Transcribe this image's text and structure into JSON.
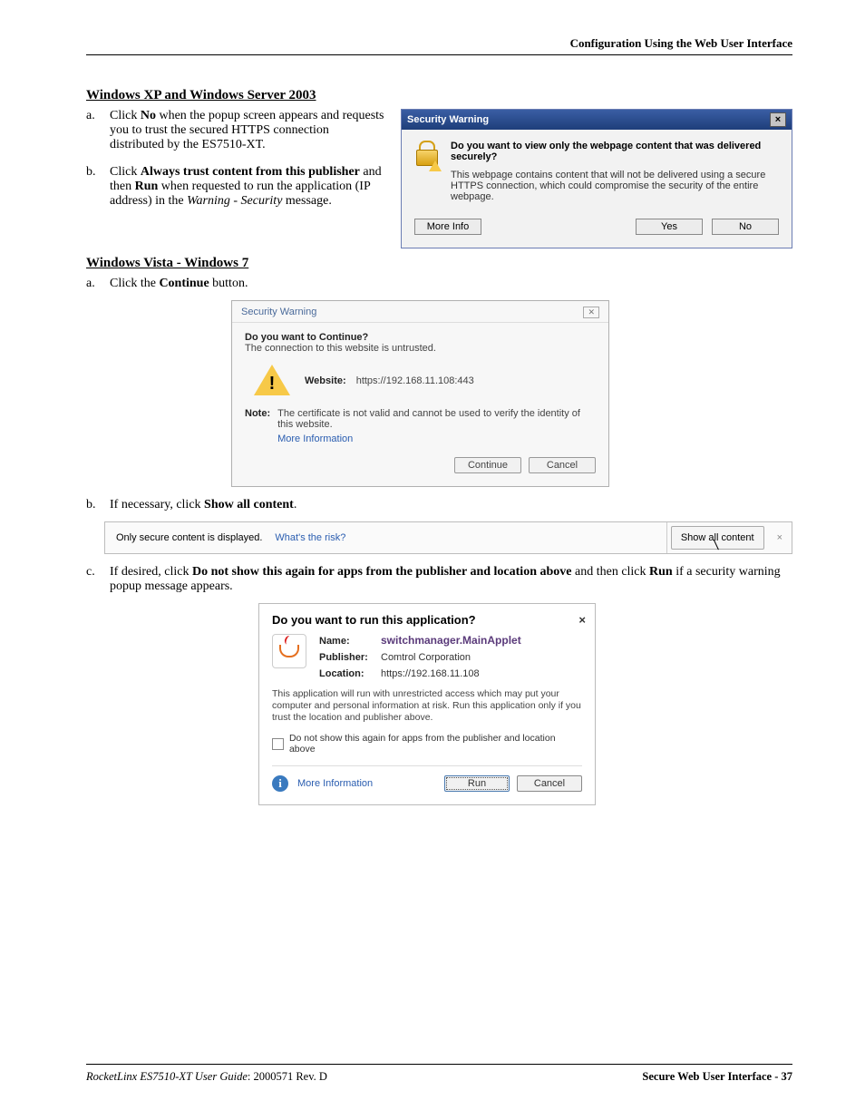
{
  "header": {
    "right": "Configuration Using the Web User Interface"
  },
  "sections": {
    "xp": {
      "title": "Windows XP and Windows Server 2003",
      "a_marker": "a.",
      "a_pre": "Click ",
      "a_bold1": "No",
      "a_post": " when the popup screen appears and requests you to trust the secured HTTPS connection distributed by the ES7510-XT.",
      "b_marker": "b.",
      "b_pre": "Click ",
      "b_bold1": "Always trust content from this publisher",
      "b_mid1": " and then ",
      "b_bold2": "Run",
      "b_mid2": " when requested to run the application (IP address) in the ",
      "b_ital": "Warning - Security",
      "b_post": " message."
    },
    "vista": {
      "title": "Windows Vista - Windows 7",
      "a_marker": "a.",
      "a_pre": "Click the ",
      "a_bold": "Continue",
      "a_post": " button.",
      "b_marker": "b.",
      "b_pre": "If necessary, click ",
      "b_bold": "Show all content",
      "b_post": ".",
      "c_marker": "c.",
      "c_pre": "If desired, click ",
      "c_bold1": "Do not show this again for apps from the publisher and location above",
      "c_mid": " and then click ",
      "c_bold2": "Run",
      "c_post": " if a security warning popup message appears."
    }
  },
  "dlgXp": {
    "title": "Security Warning",
    "question": "Do you want to view only the webpage content that was delivered securely?",
    "message": "This webpage contains content that will not be delivered using a secure HTTPS connection, which could compromise the security of the entire webpage.",
    "moreInfo": "More Info",
    "yes": "Yes",
    "no": "No"
  },
  "dlgVista": {
    "title": "Security Warning",
    "question": "Do you want to Continue?",
    "subtitle": "The connection to this website is untrusted.",
    "websiteLabel": "Website:",
    "websiteValue": "https://192.168.11.108:443",
    "noteLabel": "Note:",
    "noteText": "The certificate is not valid and cannot be used to verify the identity of this website.",
    "moreInfo": "More Information",
    "continue": "Continue",
    "cancel": "Cancel"
  },
  "infobar": {
    "msg": "Only secure content is displayed.",
    "risk": "What's the risk?",
    "showAll": "Show all content",
    "close": "×"
  },
  "dlgRun": {
    "question": "Do you want to run this application?",
    "close": "×",
    "nameLabel": "Name:",
    "nameValue": "switchmanager.MainApplet",
    "pubLabel": "Publisher:",
    "pubValue": "Comtrol Corporation",
    "locLabel": "Location:",
    "locValue": "https://192.168.11.108",
    "msg": "This application will run with unrestricted access which may put your computer and personal information at risk. Run this application only if you trust the location and publisher above.",
    "checkbox": "Do not show this again for apps from the publisher and location above",
    "moreInfo": "More Information",
    "run": "Run",
    "cancel": "Cancel"
  },
  "footer": {
    "leftItalic": "RocketLinx ES7510-XT  User Guide",
    "leftRev": ": 2000571 Rev. D",
    "right": "Secure Web User Interface - 37"
  }
}
